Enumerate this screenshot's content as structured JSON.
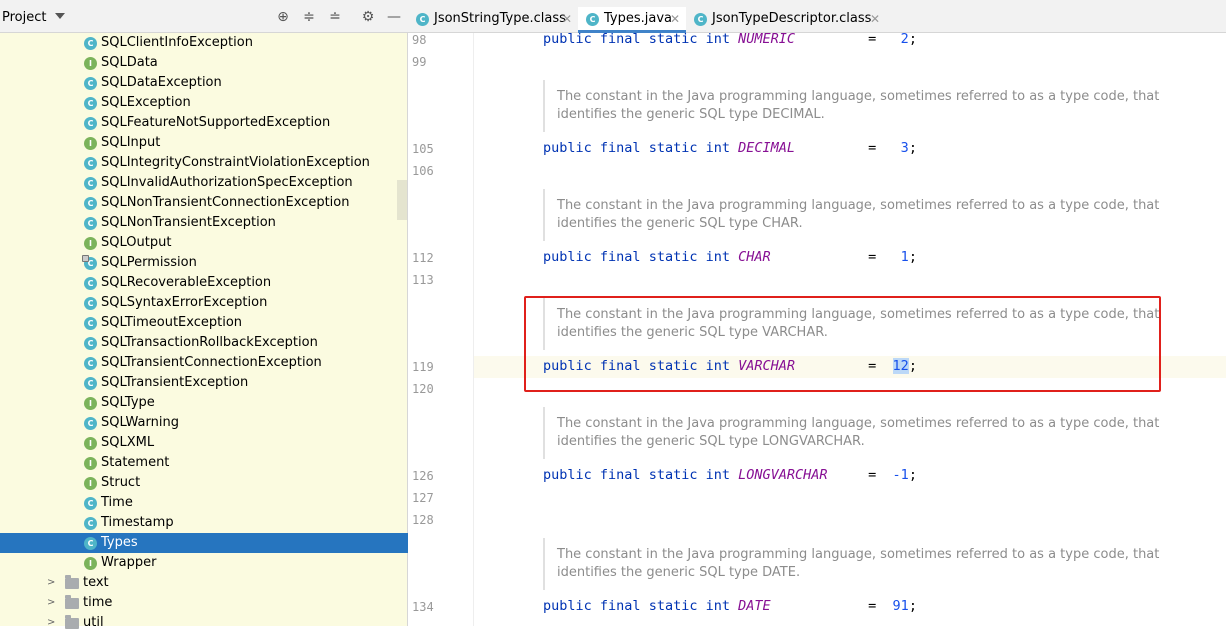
{
  "project_panel": {
    "title": "Project",
    "tree_items": [
      {
        "label": "SQLClientInfoException",
        "kind": "C"
      },
      {
        "label": "SQLData",
        "kind": "I"
      },
      {
        "label": "SQLDataException",
        "kind": "C"
      },
      {
        "label": "SQLException",
        "kind": "C"
      },
      {
        "label": "SQLFeatureNotSupportedException",
        "kind": "C"
      },
      {
        "label": "SQLInput",
        "kind": "I"
      },
      {
        "label": "SQLIntegrityConstraintViolationException",
        "kind": "C"
      },
      {
        "label": "SQLInvalidAuthorizationSpecException",
        "kind": "C"
      },
      {
        "label": "SQLNonTransientConnectionException",
        "kind": "C"
      },
      {
        "label": "SQLNonTransientException",
        "kind": "C"
      },
      {
        "label": "SQLOutput",
        "kind": "I"
      },
      {
        "label": "SQLPermission",
        "kind": "C"
      },
      {
        "label": "SQLRecoverableException",
        "kind": "C"
      },
      {
        "label": "SQLSyntaxErrorException",
        "kind": "C"
      },
      {
        "label": "SQLTimeoutException",
        "kind": "C"
      },
      {
        "label": "SQLTransactionRollbackException",
        "kind": "C"
      },
      {
        "label": "SQLTransientConnectionException",
        "kind": "C"
      },
      {
        "label": "SQLTransientException",
        "kind": "C"
      },
      {
        "label": "SQLType",
        "kind": "I"
      },
      {
        "label": "SQLWarning",
        "kind": "C"
      },
      {
        "label": "SQLXML",
        "kind": "I"
      },
      {
        "label": "Statement",
        "kind": "I"
      },
      {
        "label": "Struct",
        "kind": "I"
      },
      {
        "label": "Time",
        "kind": "C"
      },
      {
        "label": "Timestamp",
        "kind": "C"
      },
      {
        "label": "Types",
        "kind": "C"
      },
      {
        "label": "Wrapper",
        "kind": "I"
      }
    ],
    "packages": [
      "text",
      "time",
      "util"
    ],
    "selected": "Types"
  },
  "tabs": [
    {
      "label": "JsonStringType.class"
    },
    {
      "label": "Types.java"
    },
    {
      "label": "JsonTypeDescriptor.class"
    }
  ],
  "editor": {
    "doc_prefix": "The constant in the Java programming language, sometimes referred to as a type code, that",
    "doc_suffix_prefix": "identifies the generic SQL type",
    "lines": {
      "l98": "98",
      "l99": "99",
      "l105": "105",
      "l106": "106",
      "l112": "112",
      "l113": "113",
      "l119": "119",
      "l120": "120",
      "l126": "126",
      "l127": "127",
      "l128": "128",
      "l134": "134"
    },
    "keywords": {
      "public": "public",
      "final": "final",
      "static": "static",
      "int": "int"
    },
    "constants": [
      {
        "name": "NUMERIC",
        "value": "2"
      },
      {
        "name": "DECIMAL",
        "value": "3",
        "doc_type": "DECIMAL."
      },
      {
        "name": "CHAR",
        "value": "1",
        "doc_type": "CHAR."
      },
      {
        "name": "VARCHAR",
        "value": "12",
        "doc_type": "VARCHAR."
      },
      {
        "name": "LONGVARCHAR",
        "value": "-1",
        "doc_type": "LONGVARCHAR."
      },
      {
        "name": "DATE",
        "value": "91",
        "doc_type": "DATE."
      }
    ]
  }
}
